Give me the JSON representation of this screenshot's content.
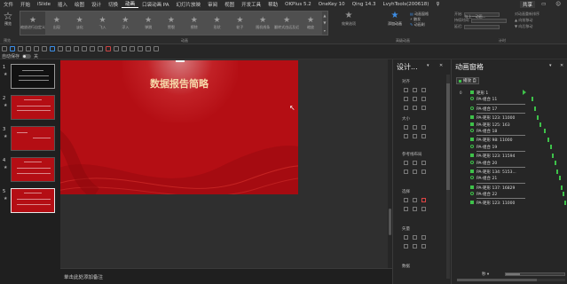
{
  "menu": {
    "items": [
      "文件",
      "开始",
      "iSlide",
      "插入",
      "绘图",
      "设计",
      "切换",
      "动画",
      "口袋动画 PA",
      "幻灯片放映",
      "审阅",
      "视图",
      "开发工具",
      "帮助",
      "OKPlus 5.2",
      "OneKey 10",
      "Qing 14.3",
      "LvyhTools(200618)",
      "♀"
    ],
    "active_index": 7,
    "share_label": "共享",
    "comment_glyph": "▭",
    "user_glyph": "☺"
  },
  "ribbon": {
    "preview_label": "预览",
    "animations": [
      {
        "label": "缩放进行自定义"
      },
      {
        "label": "出现"
      },
      {
        "label": "淡化"
      },
      {
        "label": "飞入"
      },
      {
        "label": "浮入"
      },
      {
        "label": "弹跳"
      },
      {
        "label": "劈裂"
      },
      {
        "label": "擦除"
      },
      {
        "label": "形状"
      },
      {
        "label": "轮子"
      },
      {
        "label": "随机线条"
      },
      {
        "label": "翻转式由远及近"
      },
      {
        "label": "缩放"
      },
      {
        "label": "旋转"
      },
      {
        "label": "弹跳入"
      },
      {
        "label": "其他动作路径"
      }
    ],
    "effect_options_label": "效果选项",
    "add_animation_label": "添加动画",
    "advanced": {
      "pane": "动画窗格",
      "trigger": "触发",
      "painter": "动画刷"
    },
    "timing": {
      "start_label": "开始:",
      "start_value": "与上一动画...",
      "duration_label": "持续时间:",
      "delay_label": "延迟:"
    },
    "reorder": {
      "title": "对动画重新排序",
      "earlier": "▲ 向前移动",
      "later": "▼ 向后移动"
    },
    "groups": {
      "preview": "预览",
      "animation": "动画",
      "advanced": "高级动画",
      "timing": "计时"
    }
  },
  "toolbar": {
    "autosave_label": "自动保存",
    "autosave_state": "关"
  },
  "slides": [
    {
      "number": "1",
      "star": "★"
    },
    {
      "number": "2",
      "star": "★"
    },
    {
      "number": "3",
      "star": "★"
    },
    {
      "number": "4",
      "star": "★"
    },
    {
      "number": "5",
      "star": "★"
    }
  ],
  "slide": {
    "title": "数据报告简略"
  },
  "notes": {
    "placeholder": "单击此处添加备注"
  },
  "design_pane": {
    "title": "设计...",
    "dropdown": "▾",
    "close": "✕",
    "sections": [
      "对齐",
      "大小",
      "参考线布局",
      "选择",
      "矢量",
      "数据"
    ]
  },
  "anim_pane": {
    "title": "动画窗格",
    "dropdown": "▾",
    "close": "✕",
    "play_label": "播放 自",
    "items": [
      {
        "num": "0",
        "label": "矩形 1",
        "kind": "head"
      },
      {
        "num": "",
        "label": "PA-组合 11",
        "kind": "path"
      },
      {
        "num": "",
        "label": "PA-组合 17",
        "kind": "path"
      },
      {
        "num": "",
        "label": "PA-矩形 123: 11000",
        "kind": "fx"
      },
      {
        "num": "",
        "label": "PA-矩形 125: 163",
        "kind": "fx"
      },
      {
        "num": "",
        "label": "PA-组合 18",
        "kind": "path"
      },
      {
        "num": "",
        "label": "PA-矩形 98: 11000",
        "kind": "fx"
      },
      {
        "num": "",
        "label": "PA-组合 19",
        "kind": "path"
      },
      {
        "num": "",
        "label": "PA-矩形 123: 11594",
        "kind": "fx"
      },
      {
        "num": "",
        "label": "PA-组合 20",
        "kind": "path"
      },
      {
        "num": "",
        "label": "PA-矩形 134: 5153...",
        "kind": "fx"
      },
      {
        "num": "",
        "label": "PA-组合 21",
        "kind": "path"
      },
      {
        "num": "",
        "label": "PA-矩形 137: 16829",
        "kind": "fx"
      },
      {
        "num": "",
        "label": "PA-组合 22",
        "kind": "path"
      },
      {
        "num": "",
        "label": "PA-矩形 123: 11000",
        "kind": "fx"
      }
    ],
    "seconds_label": "秒 ▾"
  }
}
